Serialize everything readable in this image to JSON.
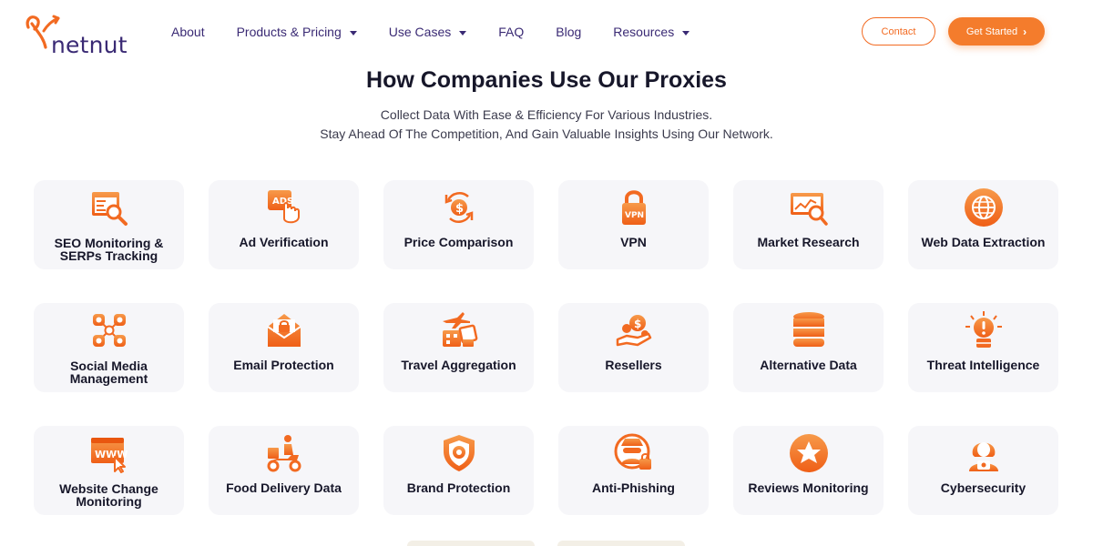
{
  "brand": {
    "name": "netnut",
    "accent": "#f26a21",
    "primary_text": "#3a2a74"
  },
  "nav": {
    "items": [
      {
        "label": "About",
        "dropdown": false
      },
      {
        "label": "Products & Pricing",
        "dropdown": true
      },
      {
        "label": "Use Cases",
        "dropdown": true
      },
      {
        "label": "FAQ",
        "dropdown": false
      },
      {
        "label": "Blog",
        "dropdown": false
      },
      {
        "label": "Resources",
        "dropdown": true
      }
    ],
    "contact_label": "Contact",
    "get_started_label": "Get Started",
    "get_started_icon": "chevron-right-icon"
  },
  "section": {
    "title": "How Companies Use Our Proxies",
    "subtitle_line1": "Collect Data With Ease & Efficiency For Various Industries.",
    "subtitle_line2": "Stay Ahead Of The Competition, And Gain Valuable Insights Using Our Network."
  },
  "use_cases": [
    {
      "label": "SEO Monitoring & SERPs Tracking",
      "line1": "SEO Monitoring &",
      "line2": "SERPs Tracking",
      "icon": "seo-monitor-icon"
    },
    {
      "label": "Ad Verification",
      "icon": "ad-verification-icon"
    },
    {
      "label": "Price Comparison",
      "icon": "price-comparison-icon"
    },
    {
      "label": "VPN",
      "icon": "vpn-lock-icon"
    },
    {
      "label": "Market Research",
      "icon": "market-research-icon"
    },
    {
      "label": "Web Data Extraction",
      "icon": "globe-icon"
    },
    {
      "label": "Social Media Management",
      "line1": "Social Media",
      "line2": "Management",
      "icon": "social-network-icon"
    },
    {
      "label": "Email Protection",
      "icon": "email-lock-icon"
    },
    {
      "label": "Travel Aggregation",
      "icon": "travel-icon"
    },
    {
      "label": "Resellers",
      "icon": "hand-coins-icon"
    },
    {
      "label": "Alternative Data",
      "icon": "database-icon"
    },
    {
      "label": "Threat Intelligence",
      "icon": "alert-bulb-icon"
    },
    {
      "label": "Website Change Monitoring",
      "line1": "Website Change",
      "line2": "Monitoring",
      "icon": "www-monitor-icon"
    },
    {
      "label": "Food Delivery Data",
      "icon": "food-delivery-icon"
    },
    {
      "label": "Brand Protection",
      "icon": "shield-icon"
    },
    {
      "label": "Anti-Phishing",
      "icon": "hacker-icon"
    },
    {
      "label": "Reviews Monitoring",
      "icon": "star-icon"
    },
    {
      "label": "Cybersecurity",
      "icon": "hooded-user-icon"
    }
  ]
}
